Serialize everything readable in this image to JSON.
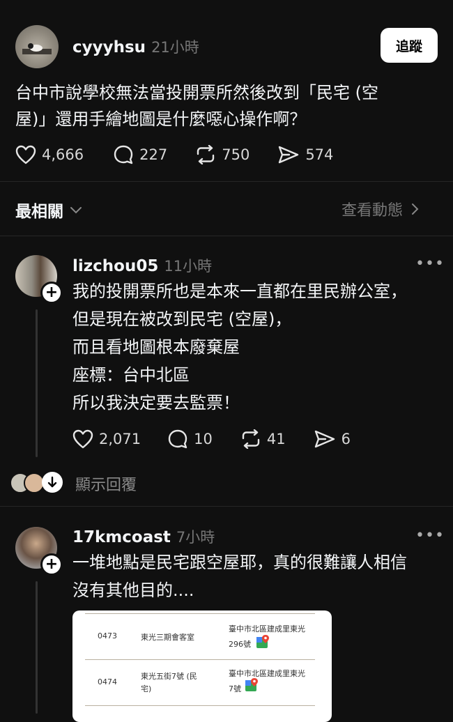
{
  "post": {
    "username": "cyyyhsu",
    "time": "21小時",
    "follow_label": "追蹤",
    "text_line1": "台中市說學校無法當投開票所然後改到「民宅 (空",
    "text_line2": "屋)」還用手繪地圖是什麼噁心操作啊？",
    "likes": "4,666",
    "replies": "227",
    "reposts": "750",
    "shares": "574"
  },
  "sort": {
    "label": "最相關",
    "view_activity": "查看動態"
  },
  "comments": [
    {
      "username": "lizchou05",
      "time": "11小時",
      "lines": [
        "我的投開票所也是本來一直都在里民辦公室，",
        "但是現在被改到民宅 (空屋)，",
        "而且看地圖根本廢棄屋",
        "座標：台中北區",
        "所以我決定要去監票！"
      ],
      "likes": "2,071",
      "replies": "10",
      "reposts": "41",
      "shares": "6",
      "show_replies": "顯示回覆"
    },
    {
      "username": "17kmcoast",
      "time": "7小時",
      "lines": [
        "一堆地點是民宅跟空屋耶，真的很難讓人相信",
        "沒有其他目的...."
      ]
    }
  ],
  "embed_table": {
    "rows": [
      {
        "no": "0473",
        "name": "東光三期會客室",
        "addr1": "臺中市北區建成里東光",
        "addr2": "296號"
      },
      {
        "no": "0474",
        "name_line1": "東光五街7號 (民",
        "name_line2": "宅)",
        "addr1": "臺中市北區建成里東光",
        "addr2": "7號"
      }
    ]
  }
}
